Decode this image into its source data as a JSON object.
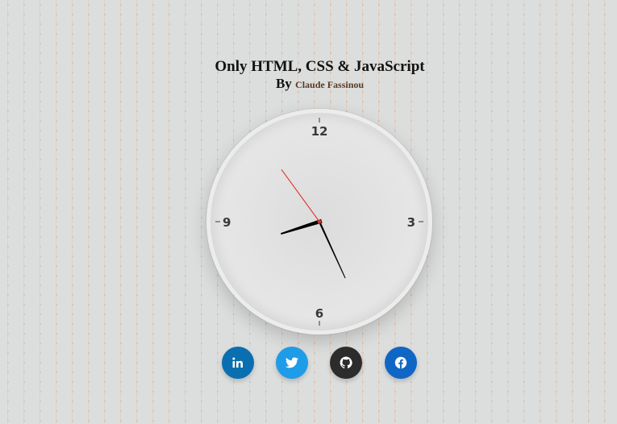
{
  "header": {
    "title": "Only HTML, CSS & JavaScript",
    "by_label": "By",
    "author": "Claude Fassinou"
  },
  "clock": {
    "numerals": {
      "twelve": "12",
      "three": "3",
      "six": "6",
      "nine": "9"
    },
    "time": {
      "hours": 8,
      "minutes": 25,
      "seconds": 54
    },
    "colors": {
      "hands": "#000000",
      "second_hand": "#e0322a"
    }
  },
  "social_links": [
    {
      "name": "linkedin",
      "icon": "linkedin-icon",
      "color": "#0a6fb0"
    },
    {
      "name": "twitter",
      "icon": "twitter-icon",
      "color": "#1f9ce8"
    },
    {
      "name": "github",
      "icon": "github-icon",
      "color": "#2c2c2c"
    },
    {
      "name": "facebook",
      "icon": "facebook-icon",
      "color": "#1066c4"
    }
  ]
}
